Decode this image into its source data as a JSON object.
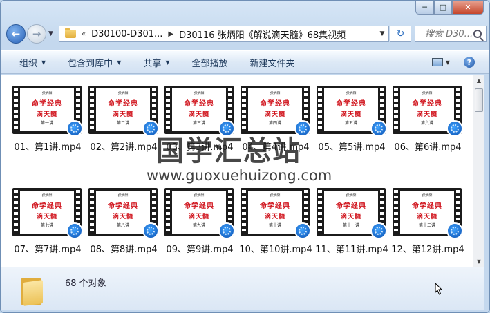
{
  "window": {
    "caption_buttons": [
      "─",
      "□",
      "✕"
    ]
  },
  "nav": {
    "back_icon": "back-arrow-icon",
    "forward_icon": "forward-arrow-icon",
    "history_arrow": "▼",
    "breadcrumb_prefix": "«",
    "breadcrumb": [
      "D30100-D301...",
      "D30116 张炳阳《解说滴天髓》68集视频"
    ],
    "breadcrumb_separator": "▶",
    "address_dropdown": "▼",
    "refresh_symbol": "↻",
    "search_placeholder": "搜索 D30..."
  },
  "toolbar": {
    "items": [
      {
        "label": "组织",
        "has_arrow": true
      },
      {
        "label": "包含到库中",
        "has_arrow": true
      },
      {
        "label": "共享",
        "has_arrow": true
      },
      {
        "label": "全部播放",
        "has_arrow": false
      },
      {
        "label": "新建文件夹",
        "has_arrow": false
      }
    ],
    "arrow_glyph": "▼",
    "help_glyph": "?"
  },
  "thumbnail": {
    "author": "张炳阳",
    "title_line1": "命学经典",
    "title_line2": "滴天髓"
  },
  "files": [
    {
      "name": "01、第1讲.mp4",
      "lecture": "第一讲"
    },
    {
      "name": "02、第2讲.mp4",
      "lecture": "第二讲"
    },
    {
      "name": "03、第3讲.mp4",
      "lecture": "第三讲"
    },
    {
      "name": "04、第4讲.mp4",
      "lecture": "第四讲"
    },
    {
      "name": "05、第5讲.mp4",
      "lecture": "第五讲"
    },
    {
      "name": "06、第6讲.mp4",
      "lecture": "第六讲"
    },
    {
      "name": "07、第7讲.mp4",
      "lecture": "第七讲"
    },
    {
      "name": "08、第8讲.mp4",
      "lecture": "第八讲"
    },
    {
      "name": "09、第9讲.mp4",
      "lecture": "第九讲"
    },
    {
      "name": "10、第10讲.mp4",
      "lecture": "第十讲"
    },
    {
      "name": "11、第11讲.mp4",
      "lecture": "第十一讲"
    },
    {
      "name": "12、第12讲.mp4",
      "lecture": "第十二讲"
    }
  ],
  "watermark": {
    "line1": "国学汇总站",
    "line2": "www.guoxuehuizong.com"
  },
  "scrollbar": {
    "up": "▲",
    "down": "▼"
  },
  "status": {
    "count_label": "68 个对象"
  }
}
